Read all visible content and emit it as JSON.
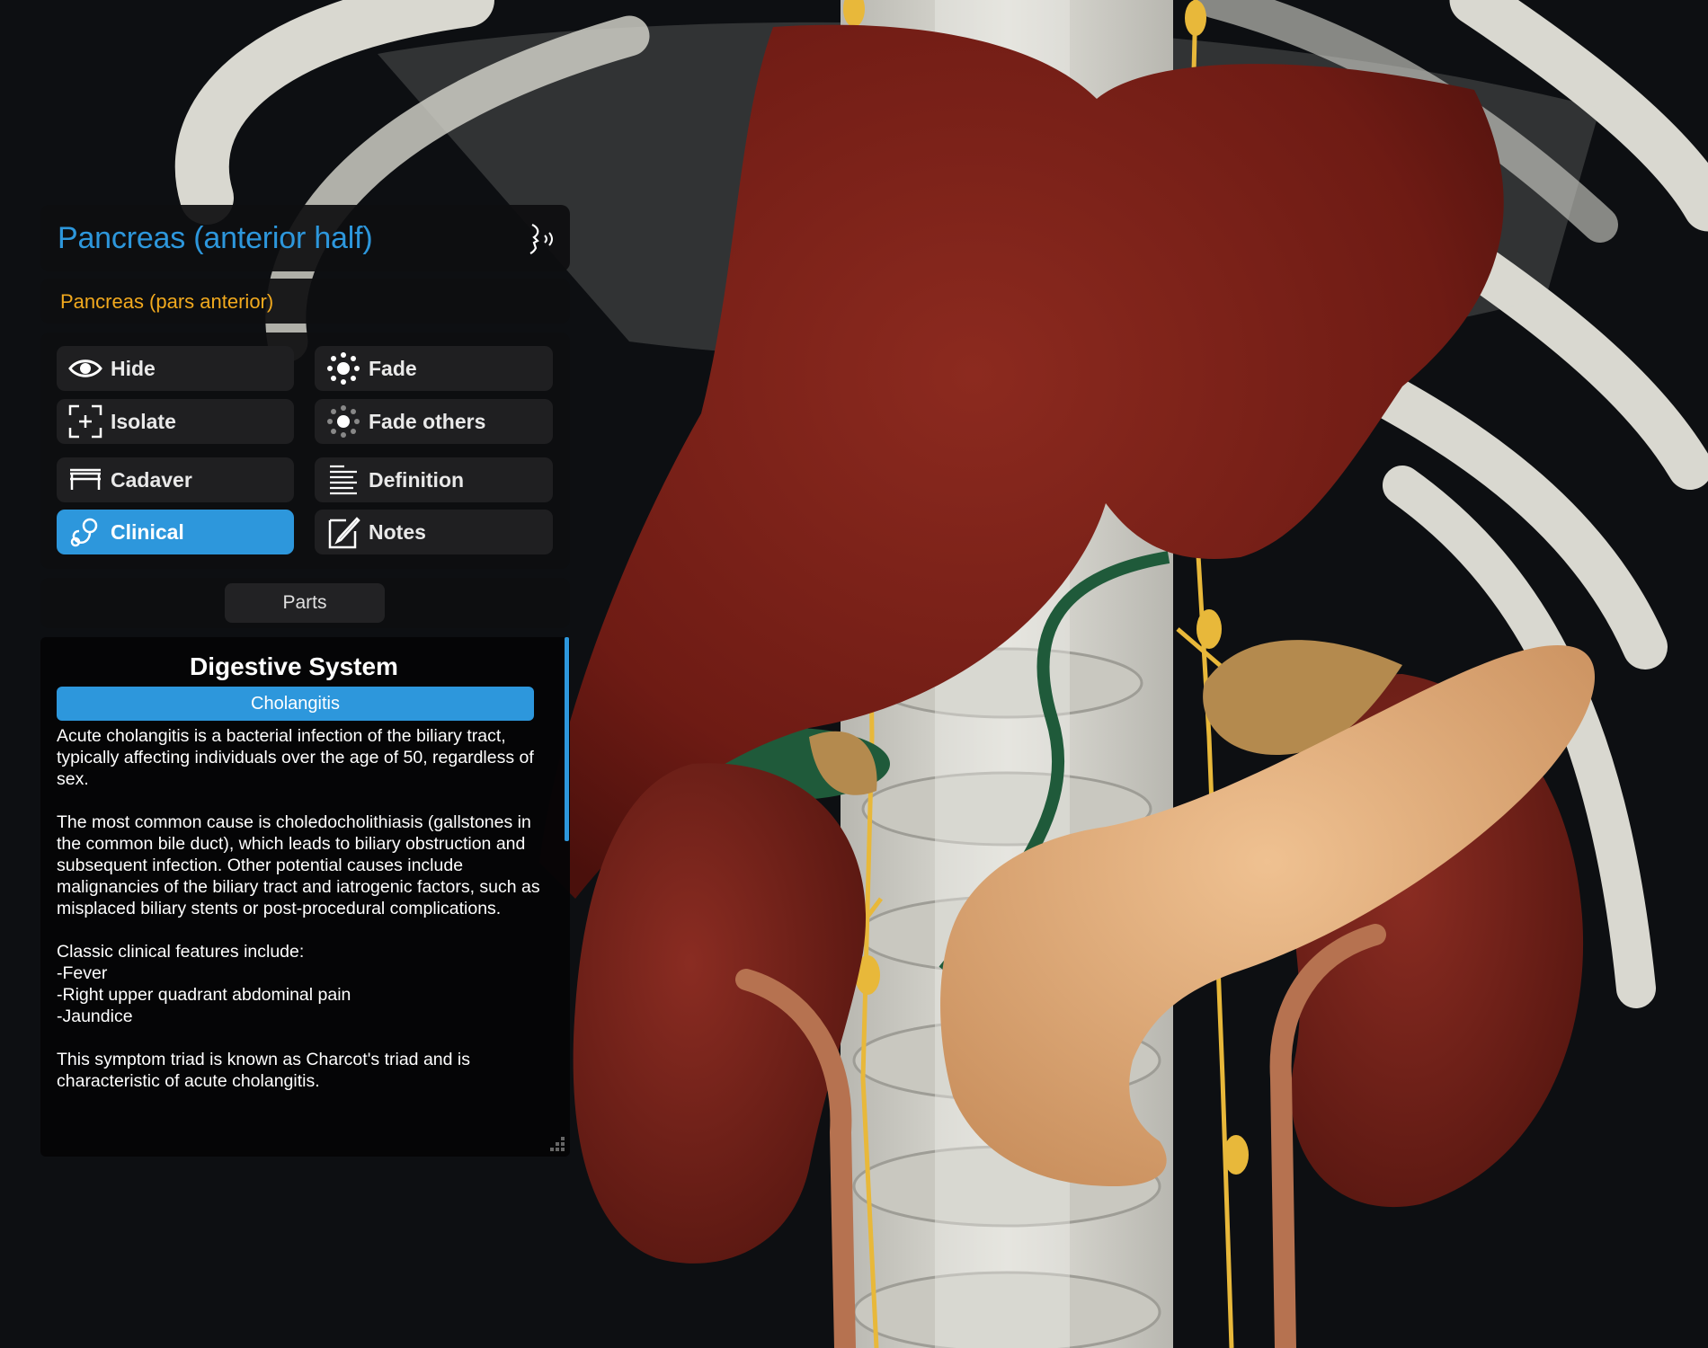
{
  "structure": {
    "name": "Pancreas (anterior half)",
    "latin_name": "Pancreas (pars anterior)"
  },
  "actions": [
    {
      "id": "hide",
      "label": "Hide",
      "icon": "eye-icon",
      "active": false
    },
    {
      "id": "fade",
      "label": "Fade",
      "icon": "fade-icon",
      "active": false
    },
    {
      "id": "isolate",
      "label": "Isolate",
      "icon": "isolate-icon",
      "active": false
    },
    {
      "id": "fade-others",
      "label": "Fade others",
      "icon": "fade-others-icon",
      "active": false
    },
    {
      "id": "cadaver",
      "label": "Cadaver",
      "icon": "cadaver-table-icon",
      "active": false
    },
    {
      "id": "definition",
      "label": "Definition",
      "icon": "text-lines-icon",
      "active": false
    },
    {
      "id": "clinical",
      "label": "Clinical",
      "icon": "stethoscope-icon",
      "active": true
    },
    {
      "id": "notes",
      "label": "Notes",
      "icon": "pencil-note-icon",
      "active": false
    }
  ],
  "parts_label": "Parts",
  "clinical": {
    "system": "Digestive System",
    "condition": "Cholangitis",
    "paragraphs": [
      "Acute cholangitis is a bacterial infection of the biliary tract, typically affecting individuals over the age of 50, regardless of sex.",
      "The most common cause is choledocholithiasis (gallstones in the common bile duct), which leads to biliary obstruction and subsequent infection. Other potential causes include malignancies of the biliary tract and iatrogenic factors, such as misplaced biliary stents or post-procedural complications.",
      "Classic clinical features include:\n-Fever\n-Right upper quadrant abdominal pain\n-Jaundice",
      "This symptom triad is known as Charcot's triad and is characteristic of acute cholangitis."
    ]
  },
  "colors": {
    "accent": "#2d97dc",
    "latin_text": "#f1a91e",
    "liver": "#7a1f17",
    "pancreas": "#e7b383",
    "bone": "#d9d8d0",
    "nerve": "#e8b83a",
    "bile_duct": "#1f5a3a",
    "adrenal": "#b48a4e",
    "ureter": "#b67250"
  }
}
